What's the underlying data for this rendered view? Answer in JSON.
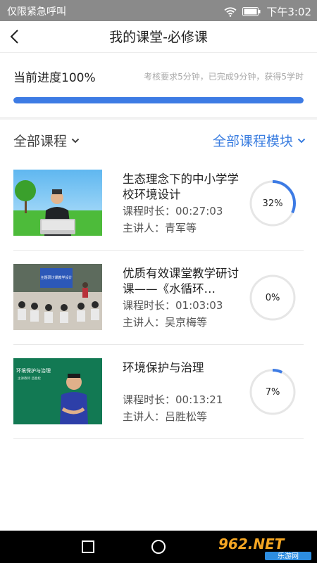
{
  "status_bar": {
    "carrier": "仅限紧急呼叫",
    "time": "下午3:02",
    "icons": [
      "wifi-icon",
      "battery-icon"
    ]
  },
  "header": {
    "title": "我的课堂-必修课",
    "back_icon": "chevron-left-icon"
  },
  "progress": {
    "label": "当前进度100%",
    "info": "考核要求5分钟，已完成9分钟，获得5学时",
    "fraction": 1.0,
    "color": "#3d7be4"
  },
  "filters": {
    "left_label": "全部课程",
    "right_label": "全部课程模块",
    "accent_color": "#3b7ee0"
  },
  "courses": [
    {
      "title": "生态理念下的中小学学校环境设计",
      "duration": "课程时长：00:27:03",
      "lecturer": "主讲人：青军等",
      "progress_text": "32%",
      "progress": 0.32
    },
    {
      "title": "优质有效课堂教学研讨课——《水循环…",
      "duration": "课程时长：01:03:03",
      "lecturer": "主讲人：吴京梅等",
      "progress_text": "0%",
      "progress": 0.0
    },
    {
      "title": " 环境保护与治理",
      "duration": "课程时长：00:13:21",
      "lecturer": "主讲人：吕胜松等",
      "progress_text": "7%",
      "progress": 0.07
    }
  ],
  "thumb_texts": {
    "thumb2_screen": "主题研讨课教学设计",
    "thumb3_board": "环境保护与治理",
    "thumb3_sub": "主讲教师 吕胜松"
  },
  "watermark": {
    "main": "962.NET",
    "sub": "乐游网"
  }
}
